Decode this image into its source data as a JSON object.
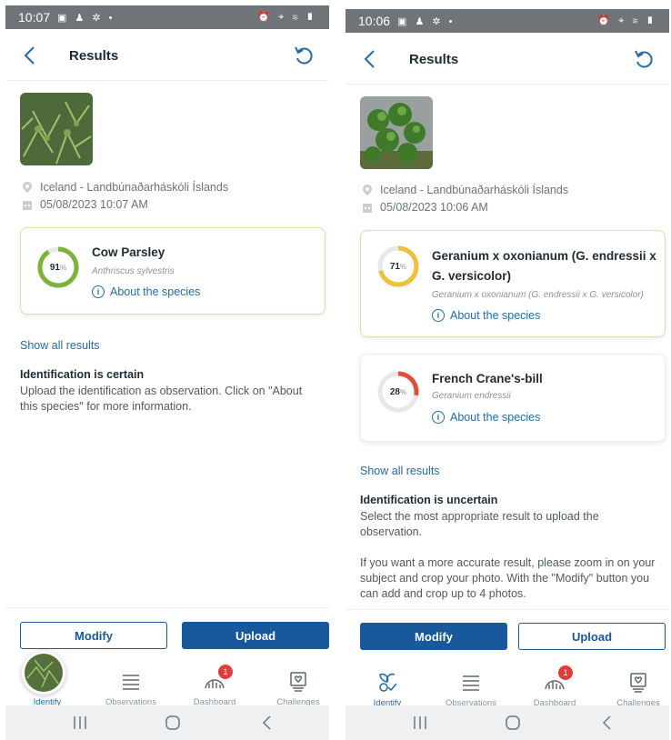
{
  "screens": [
    {
      "status": {
        "time": "10:07"
      },
      "appbar": {
        "title": "Results"
      },
      "location": "Iceland - Landbúnaðarháskóli Íslands",
      "datetime": "05/08/2023 10:07 AM",
      "results": [
        {
          "name": "Cow Parsley",
          "latin": "Anthriscus sylvestris",
          "percent": "91",
          "percent_sign": "%",
          "value": 0.91,
          "ring_color": "#7db33a",
          "about": "About the species"
        }
      ],
      "show_all": "Show all results",
      "ident_title": "Identification is certain",
      "ident_text": "Upload the identification as observation. Click on \"About this species\" for more information.",
      "buttons": {
        "modify": "Modify",
        "upload": "Upload"
      },
      "nav": {
        "identify": "Identify",
        "observations": "Observations",
        "dashboard": "Dashboard",
        "dashboard_badge": "1",
        "challenges": "Challenges"
      }
    },
    {
      "status": {
        "time": "10:06"
      },
      "appbar": {
        "title": "Results"
      },
      "location": "Iceland - Landbúnaðarháskóli Íslands",
      "datetime": "05/08/2023 10:06 AM",
      "results": [
        {
          "name": "Geranium x oxonianum (G. endressii x G. versicolor)",
          "latin": "Geranium x oxonianum (G. endressii x G. versicolor)",
          "percent": "71",
          "percent_sign": "%",
          "value": 0.71,
          "ring_color": "#f0c03c",
          "about": "About the species"
        },
        {
          "name": "French Crane's-bill",
          "latin": "Geranium endressii",
          "percent": "28",
          "percent_sign": "%",
          "value": 0.28,
          "ring_color": "#e04f3c",
          "about": "About the species"
        }
      ],
      "show_all": "Show all results",
      "ident_title": "Identification is uncertain",
      "ident_text": "Select the most appropriate result to upload the observation.",
      "ident_text2": "If you want a more accurate result, please zoom in on your subject and crop your photo. With the \"Modify\" button you can add and crop up to 4 photos.",
      "buttons": {
        "modify": "Modify",
        "upload": "Upload"
      },
      "nav": {
        "identify": "Identify",
        "observations": "Observations",
        "dashboard": "Dashboard",
        "dashboard_badge": "1",
        "challenges": "Challenges"
      }
    }
  ],
  "colors": {
    "primary": "#17599b",
    "link": "#236ba7",
    "selected_border": "#cfe6b0",
    "status_bar": "#6f7478",
    "badge": "#e03c3c"
  },
  "icons": [
    "back-chevron-icon",
    "refresh-icon",
    "location-pin-icon",
    "calendar-icon",
    "info-icon",
    "identify-icon",
    "observations-icon",
    "dashboard-icon",
    "challenges-icon",
    "recents-icon",
    "home-icon",
    "system-back-icon"
  ]
}
